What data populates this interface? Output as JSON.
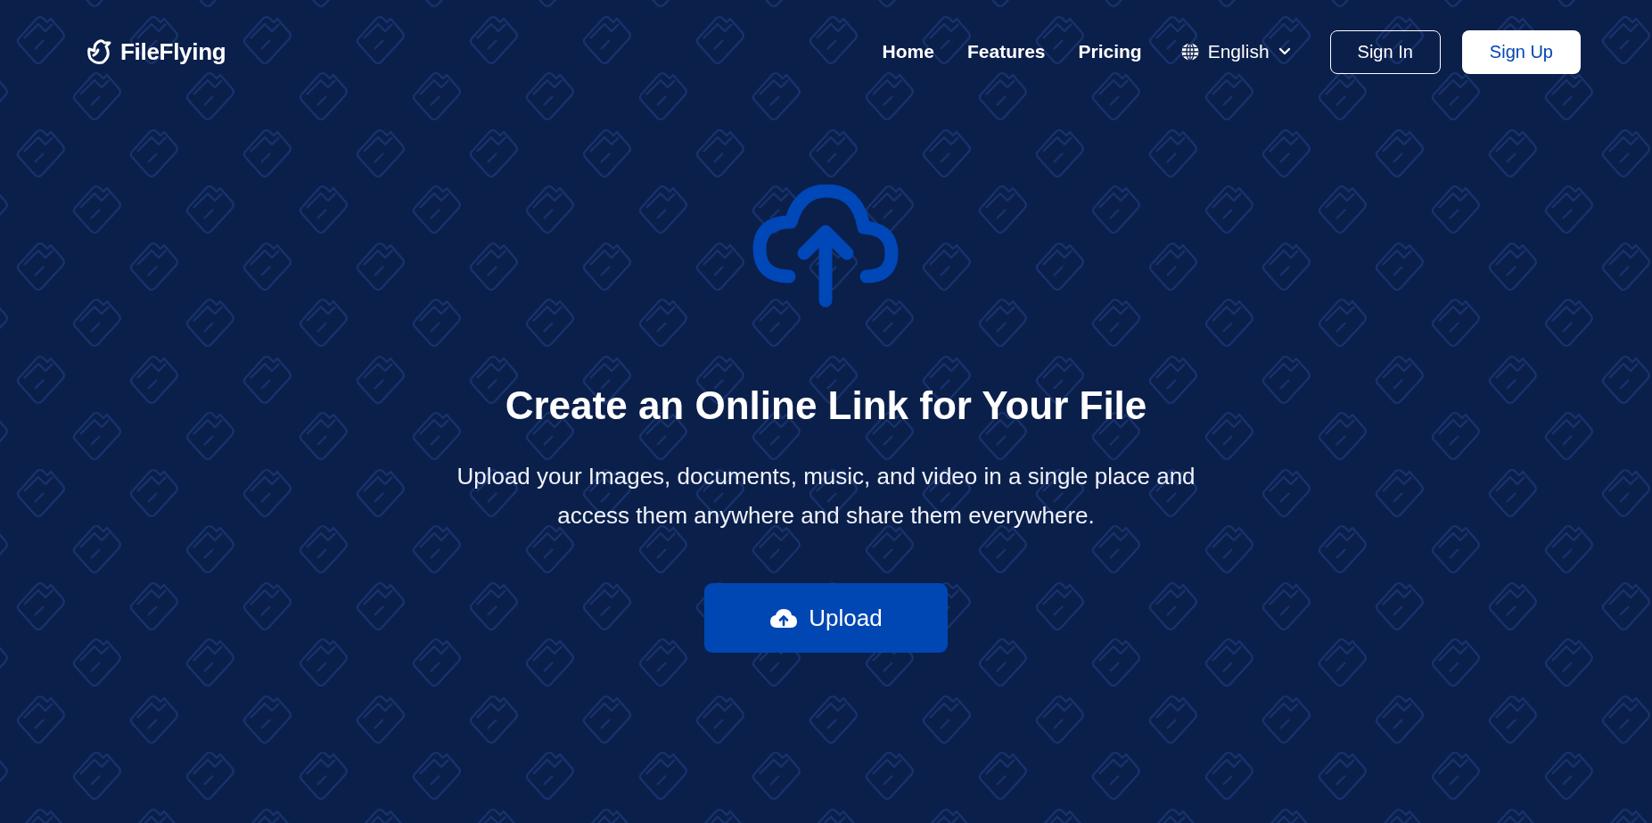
{
  "brand": {
    "name": "FileFlying"
  },
  "nav": [
    {
      "label": "Home"
    },
    {
      "label": "Features"
    },
    {
      "label": "Pricing"
    }
  ],
  "language": {
    "label": "English"
  },
  "auth": [
    {
      "label": "Sign In",
      "kind": "outline"
    },
    {
      "label": "Sign Up",
      "kind": "solid"
    }
  ],
  "hero": {
    "title": "Create an Online Link for Your File",
    "subtitle": [
      "Upload your Images, documents, music, and video in a single place and",
      "access them anywhere and share them everywhere."
    ],
    "button": "Upload"
  }
}
